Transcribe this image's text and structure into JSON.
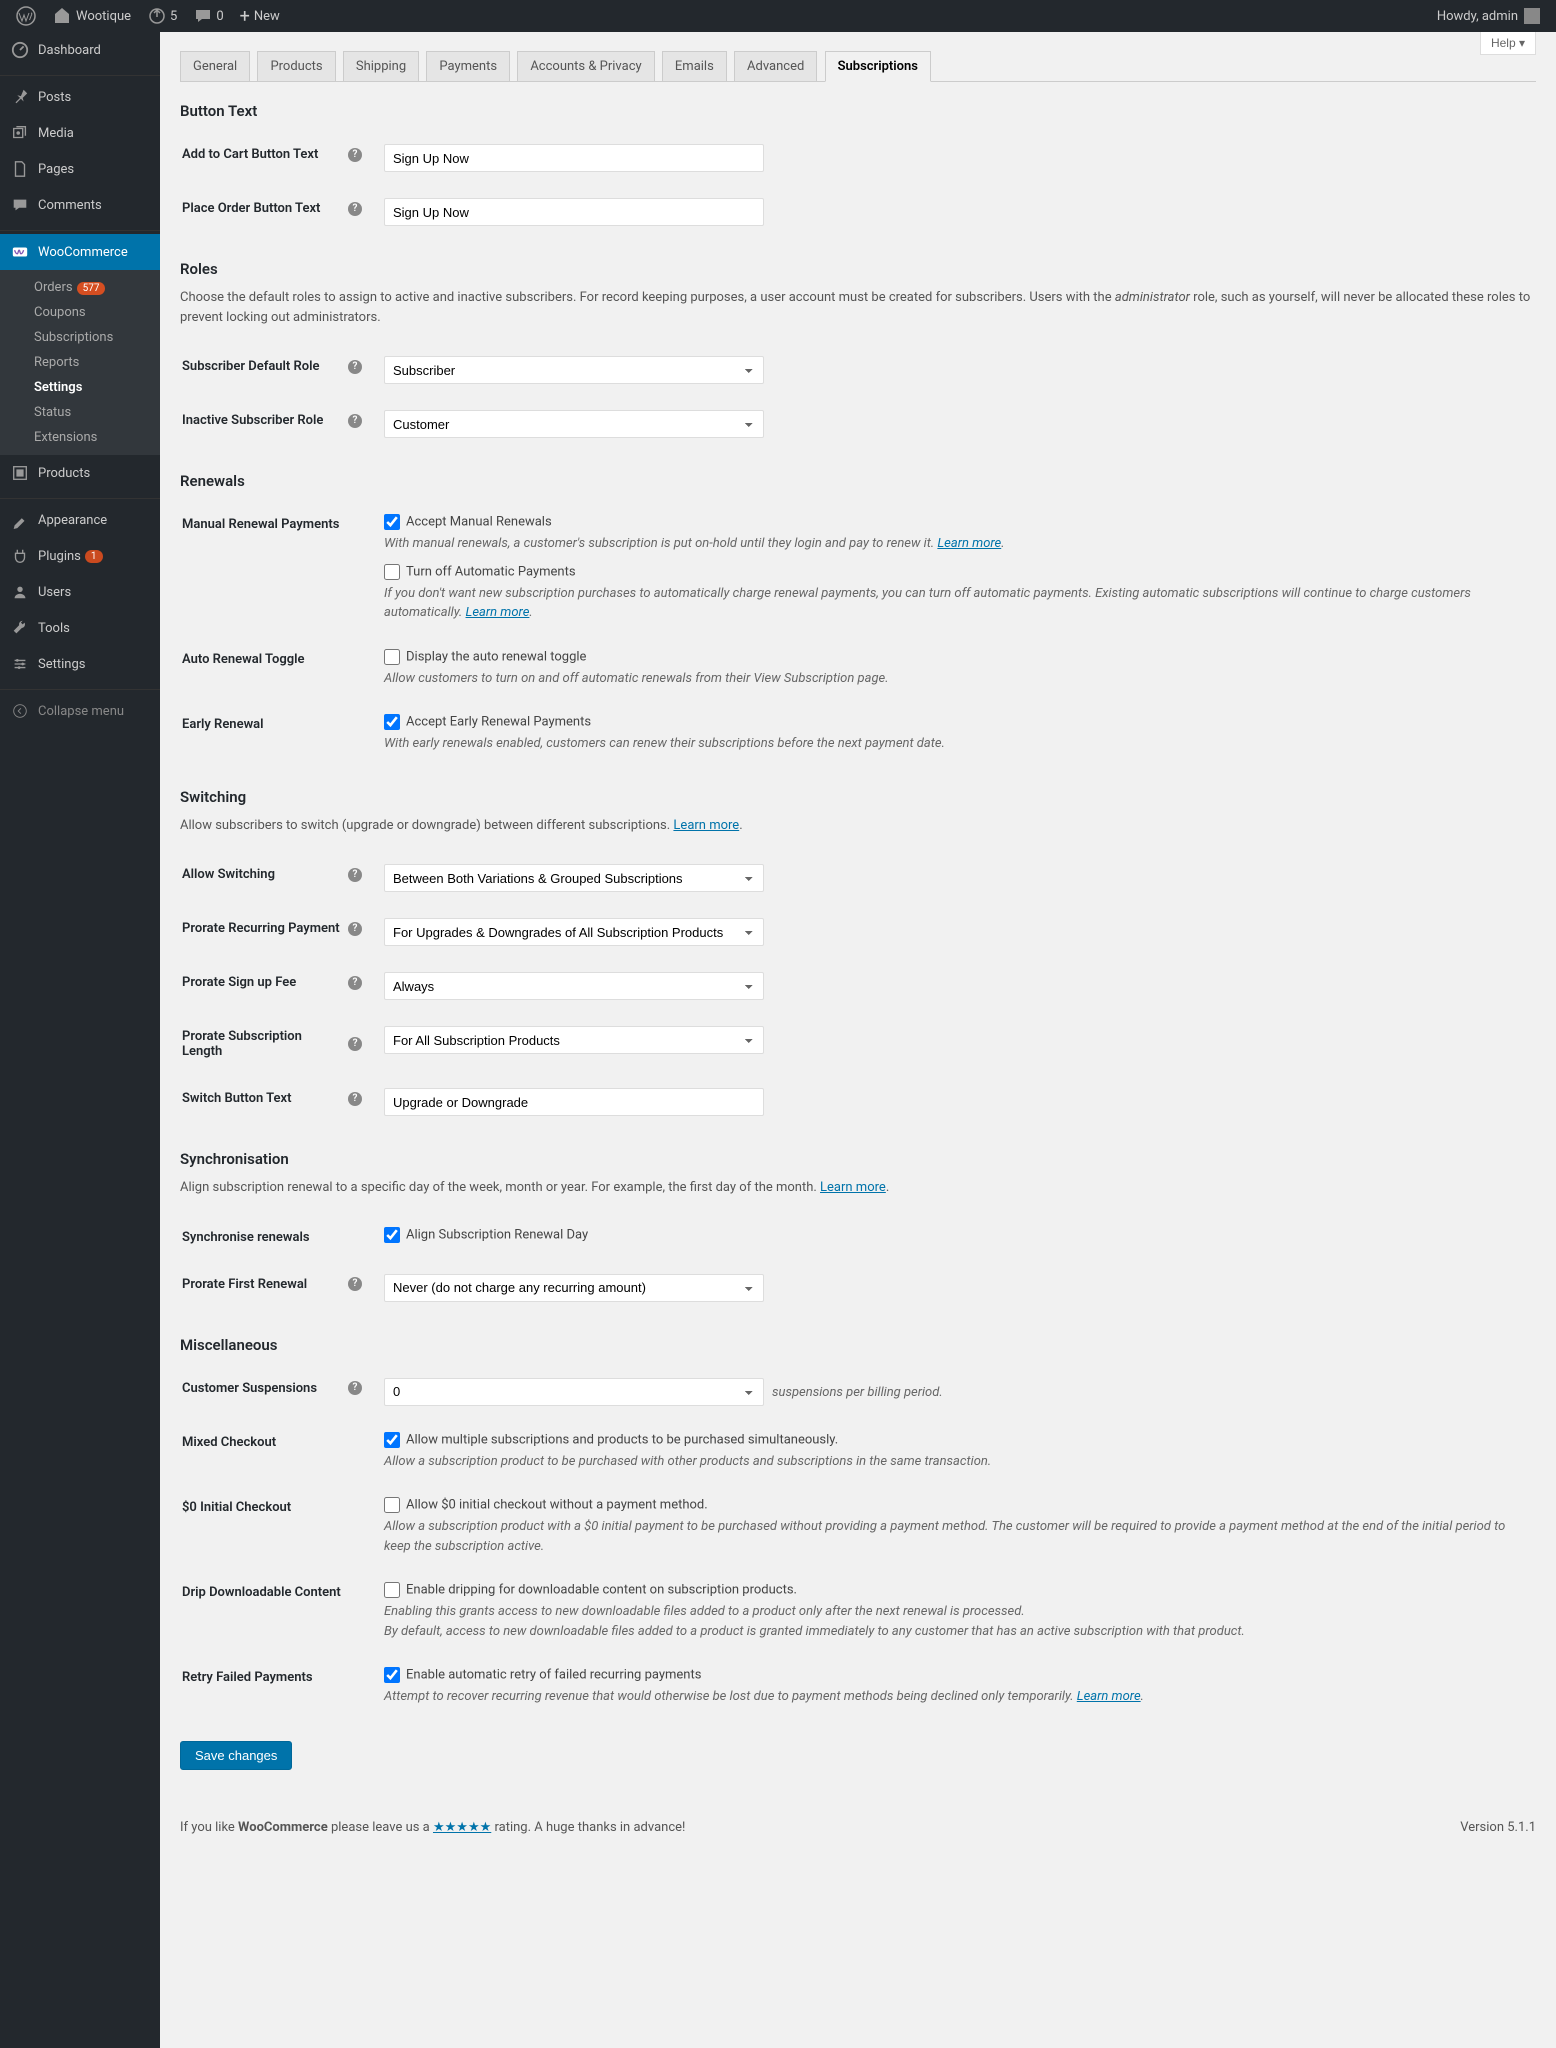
{
  "adminbar": {
    "site_name": "Wootique",
    "updates": "5",
    "comments": "0",
    "new": "New",
    "howdy": "Howdy, admin"
  },
  "menu": {
    "dashboard": "Dashboard",
    "posts": "Posts",
    "media": "Media",
    "pages": "Pages",
    "comments": "Comments",
    "woocommerce": "WooCommerce",
    "orders": "Orders",
    "orders_badge": "577",
    "coupons": "Coupons",
    "subscriptions": "Subscriptions",
    "reports": "Reports",
    "settings": "Settings",
    "status": "Status",
    "extensions": "Extensions",
    "products": "Products",
    "appearance": "Appearance",
    "plugins": "Plugins",
    "plugins_badge": "1",
    "users": "Users",
    "tools": "Tools",
    "wsettings": "Settings",
    "collapse": "Collapse menu"
  },
  "help_btn": "Help",
  "tabs": {
    "general": "General",
    "products": "Products",
    "shipping": "Shipping",
    "payments": "Payments",
    "accounts": "Accounts & Privacy",
    "emails": "Emails",
    "advanced": "Advanced",
    "subscriptions": "Subscriptions"
  },
  "sections": {
    "button_text": "Button Text",
    "roles": "Roles",
    "renewals": "Renewals",
    "switching": "Switching",
    "sync": "Synchronisation",
    "misc": "Miscellaneous"
  },
  "labels": {
    "add_to_cart": "Add to Cart Button Text",
    "place_order": "Place Order Button Text",
    "roles_desc_a": "Choose the default roles to assign to active and inactive subscribers. For record keeping purposes, a user account must be created for subscribers. Users with the ",
    "roles_desc_b": "administrator",
    "roles_desc_c": " role, such as yourself, will never be allocated these roles to prevent locking out administrators.",
    "sub_default_role": "Subscriber Default Role",
    "inactive_role": "Inactive Subscriber Role",
    "manual_renewal": "Manual Renewal Payments",
    "accept_manual": "Accept Manual Renewals",
    "manual_hint": "With manual renewals, a customer's subscription is put on-hold until they login and pay to renew it. ",
    "turn_off_auto": "Turn off Automatic Payments",
    "turn_off_hint": "If you don't want new subscription purchases to automatically charge renewal payments, you can turn off automatic payments. Existing automatic subscriptions will continue to charge customers automatically. ",
    "auto_toggle": "Auto Renewal Toggle",
    "display_toggle": "Display the auto renewal toggle",
    "toggle_hint": "Allow customers to turn on and off automatic renewals from their View Subscription page.",
    "early_renewal": "Early Renewal",
    "accept_early": "Accept Early Renewal Payments",
    "early_hint": "With early renewals enabled, customers can renew their subscriptions before the next payment date.",
    "switch_desc": "Allow subscribers to switch (upgrade or downgrade) between different subscriptions. ",
    "allow_switch": "Allow Switching",
    "prorate_recurring": "Prorate Recurring Payment",
    "prorate_signup": "Prorate Sign up Fee",
    "prorate_length": "Prorate Subscription Length",
    "switch_btn": "Switch Button Text",
    "sync_desc": "Align subscription renewal to a specific day of the week, month or year. For example, the first day of the month. ",
    "sync_renewals": "Synchronise renewals",
    "align_day": "Align Subscription Renewal Day",
    "prorate_first": "Prorate First Renewal",
    "cust_susp": "Customer Suspensions",
    "susp_suffix": "suspensions per billing period.",
    "mixed_checkout": "Mixed Checkout",
    "mixed_cb": "Allow multiple subscriptions and products to be purchased simultaneously.",
    "mixed_hint": "Allow a subscription product to be purchased with other products and subscriptions in the same transaction.",
    "zero_checkout": "$0 Initial Checkout",
    "zero_cb": "Allow $0 initial checkout without a payment method.",
    "zero_hint": "Allow a subscription product with a $0 initial payment to be purchased without providing a payment method. The customer will be required to provide a payment method at the end of the initial period to keep the subscription active.",
    "drip": "Drip Downloadable Content",
    "drip_cb": "Enable dripping for downloadable content on subscription products.",
    "drip_hint1": "Enabling this grants access to new downloadable files added to a product only after the next renewal is processed.",
    "drip_hint2": "By default, access to new downloadable files added to a product is granted immediately to any customer that has an active subscription with that product.",
    "retry": "Retry Failed Payments",
    "retry_cb": "Enable automatic retry of failed recurring payments",
    "retry_hint": "Attempt to recover recurring revenue that would otherwise be lost due to payment methods being declined only temporarily. ",
    "learn_more": "Learn more",
    "save": "Save changes"
  },
  "values": {
    "add_to_cart": "Sign Up Now",
    "place_order": "Sign Up Now",
    "sub_default_role": "Subscriber",
    "inactive_role": "Customer",
    "accept_manual": true,
    "turn_off_auto": false,
    "display_toggle": false,
    "accept_early": true,
    "allow_switch": "Between Both Variations & Grouped Subscriptions",
    "prorate_recurring": "For Upgrades & Downgrades of All Subscription Products",
    "prorate_signup": "Always",
    "prorate_length": "For All Subscription Products",
    "switch_btn": "Upgrade or Downgrade",
    "align_day": true,
    "prorate_first": "Never (do not charge any recurring amount)",
    "cust_susp": "0",
    "mixed": true,
    "zero": false,
    "drip": false,
    "retry": true
  },
  "footer": {
    "prefix": "If you like ",
    "wc": "WooCommerce",
    "mid": " please leave us a ",
    "stars": "★★★★★",
    "suffix": " rating. A huge thanks in advance!",
    "version": "Version 5.1.1"
  }
}
